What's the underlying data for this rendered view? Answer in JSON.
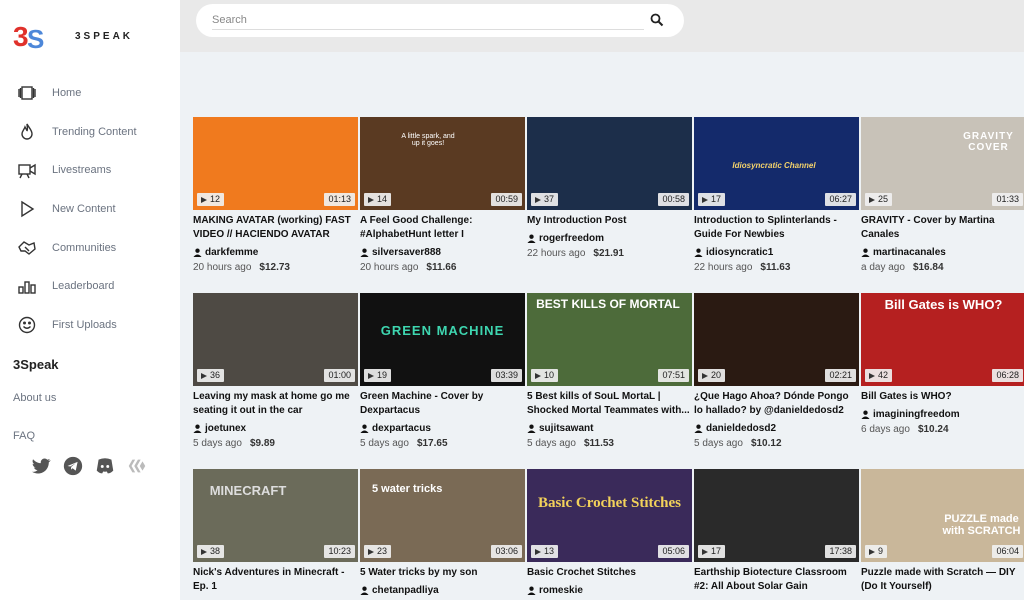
{
  "app": {
    "name": "3SPEAK"
  },
  "nav": [
    {
      "label": "Home",
      "icon": "home-icon"
    },
    {
      "label": "Trending Content",
      "icon": "flame-icon"
    },
    {
      "label": "Livestreams",
      "icon": "camera-icon"
    },
    {
      "label": "New Content",
      "icon": "play-icon"
    },
    {
      "label": "Communities",
      "icon": "handshake-icon"
    },
    {
      "label": "Leaderboard",
      "icon": "bars-icon"
    },
    {
      "label": "First Uploads",
      "icon": "smile-icon"
    }
  ],
  "sidebar": {
    "heading": "3Speak",
    "about": "About us",
    "faq": "FAQ"
  },
  "search": {
    "placeholder": "Search"
  },
  "videos": [
    {
      "views": "12",
      "duration": "01:13",
      "title": "MAKING AVATAR (working) FAST VIDEO // HACIENDO AVATAR (por...",
      "author": "darkfemme",
      "age": "20 hours ago",
      "payout": "$12.73",
      "bg": "#f07a1e"
    },
    {
      "views": "14",
      "duration": "00:59",
      "title": "A Feel Good Challenge: #AlphabetHunt letter I",
      "author": "silversaver888",
      "age": "20 hours ago",
      "payout": "$11.66",
      "bg": "#5a3a22",
      "thumb_text": "A little spark, and up it goes!"
    },
    {
      "views": "37",
      "duration": "00:58",
      "title": "My Introduction Post",
      "author": "rogerfreedom",
      "age": "22 hours ago",
      "payout": "$21.91",
      "bg": "#1c2e4a"
    },
    {
      "views": "17",
      "duration": "06:27",
      "title": "Introduction to Splinterlands - Guide For Newbies",
      "author": "idiosyncratic1",
      "age": "22 hours ago",
      "payout": "$11.63",
      "bg": "#142a6b",
      "thumb_text": "Idiosyncratic Channel"
    },
    {
      "views": "25",
      "duration": "01:33",
      "title": "GRAVITY - Cover by Martina Canales",
      "author": "martinacanales",
      "age": "a day ago",
      "payout": "$16.84",
      "bg": "#c8c2b8",
      "thumb_text": "GRAVITY COVER"
    },
    {
      "views": "36",
      "duration": "01:00",
      "title": "Leaving my mask at home go me seating it out in the car",
      "author": "joetunex",
      "age": "5 days ago",
      "payout": "$9.89",
      "bg": "#4e4a44"
    },
    {
      "views": "19",
      "duration": "03:39",
      "title": "Green Machine - Cover by Dexpartacus",
      "author": "dexpartacus",
      "age": "5 days ago",
      "payout": "$17.65",
      "bg": "#111111",
      "thumb_text": "GREEN MACHINE"
    },
    {
      "views": "10",
      "duration": "07:51",
      "title": "5 Best kills of SouL MortaL | Shocked Mortal Teammates with...",
      "author": "sujitsawant",
      "age": "5 days ago",
      "payout": "$11.53",
      "bg": "#4d6b3a",
      "thumb_text": "BEST KILLS OF MORTAL"
    },
    {
      "views": "20",
      "duration": "02:21",
      "title": "¿Que Hago Ahoa? Dónde Pongo lo hallado? by @danieldedosd2",
      "author": "danieldedosd2",
      "age": "5 days ago",
      "payout": "$10.12",
      "bg": "#2a1a12"
    },
    {
      "views": "42",
      "duration": "06:28",
      "title": "Bill Gates is WHO?",
      "author": "imaginingfreedom",
      "age": "6 days ago",
      "payout": "$10.24",
      "bg": "#b52020",
      "thumb_text": "Bill Gates is WHO?"
    },
    {
      "views": "38",
      "duration": "10:23",
      "title": "Nick's Adventures in Minecraft - Ep. 1",
      "author": "",
      "age": "",
      "payout": "",
      "bg": "#6b6b5a",
      "thumb_text": "MINECRAFT"
    },
    {
      "views": "23",
      "duration": "03:06",
      "title": "5 Water tricks by my son",
      "author": "chetanpadliya",
      "age": "",
      "payout": "",
      "bg": "#7a6a55",
      "thumb_text": "5 water tricks"
    },
    {
      "views": "13",
      "duration": "05:06",
      "title": "Basic Crochet Stitches",
      "author": "romeskie",
      "age": "",
      "payout": "",
      "bg": "#3a2a5a",
      "thumb_text": "Basic Crochet Stitches"
    },
    {
      "views": "17",
      "duration": "17:38",
      "title": "Earthship Biotecture Classroom #2: All About Solar Gain",
      "author": "",
      "age": "",
      "payout": "",
      "bg": "#2a2a2a"
    },
    {
      "views": "9",
      "duration": "06:04",
      "title": "Puzzle made with Scratch — DIY (Do It Yourself)",
      "author": "",
      "age": "",
      "payout": "",
      "bg": "#c9b79a",
      "thumb_text": "PUZZLE made with SCRATCH"
    }
  ]
}
